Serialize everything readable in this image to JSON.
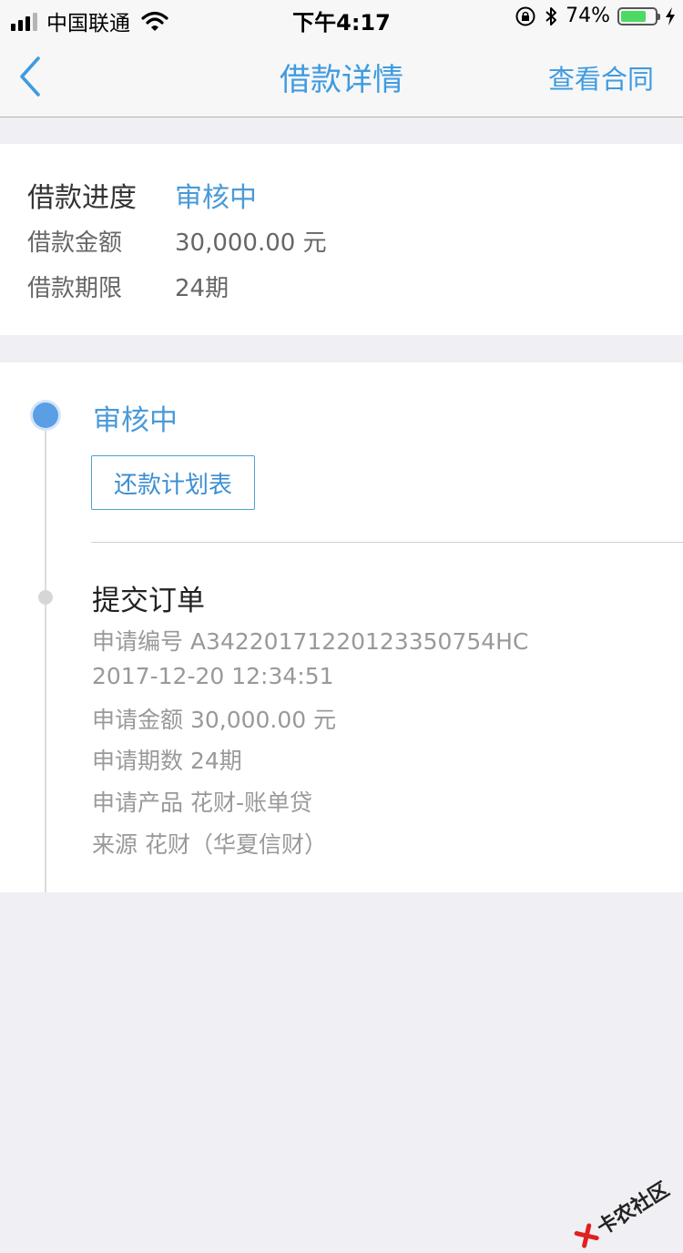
{
  "status_bar": {
    "carrier": "中国联通",
    "time": "下午4:17",
    "battery_percent_text": "74%",
    "battery_level": 0.74,
    "icons": [
      "signal-icon",
      "wifi-icon",
      "orientation-lock-icon",
      "bluetooth-icon",
      "battery-icon",
      "charging-icon"
    ]
  },
  "nav": {
    "title": "借款详情",
    "action": "查看合同"
  },
  "summary": {
    "progress_label": "借款进度",
    "progress_value": "审核中",
    "amount_label": "借款金额",
    "amount_value": "30,000.00 元",
    "term_label": "借款期限",
    "term_value": "24期"
  },
  "timeline": {
    "current_status": "审核中",
    "plan_button": "还款计划表",
    "event_title": "提交订单",
    "details": [
      "申请编号 A34220171220123350754HC",
      "2017-12-20 12:34:51",
      "申请金额 30,000.00 元",
      "申请期数 24期",
      "申请产品 花财-账单贷",
      "来源 花财（华夏信财）"
    ]
  },
  "watermark": "卡农社区",
  "colors": {
    "accent": "#4a9ad8",
    "background": "#efeff4",
    "battery": "#4cd964"
  }
}
